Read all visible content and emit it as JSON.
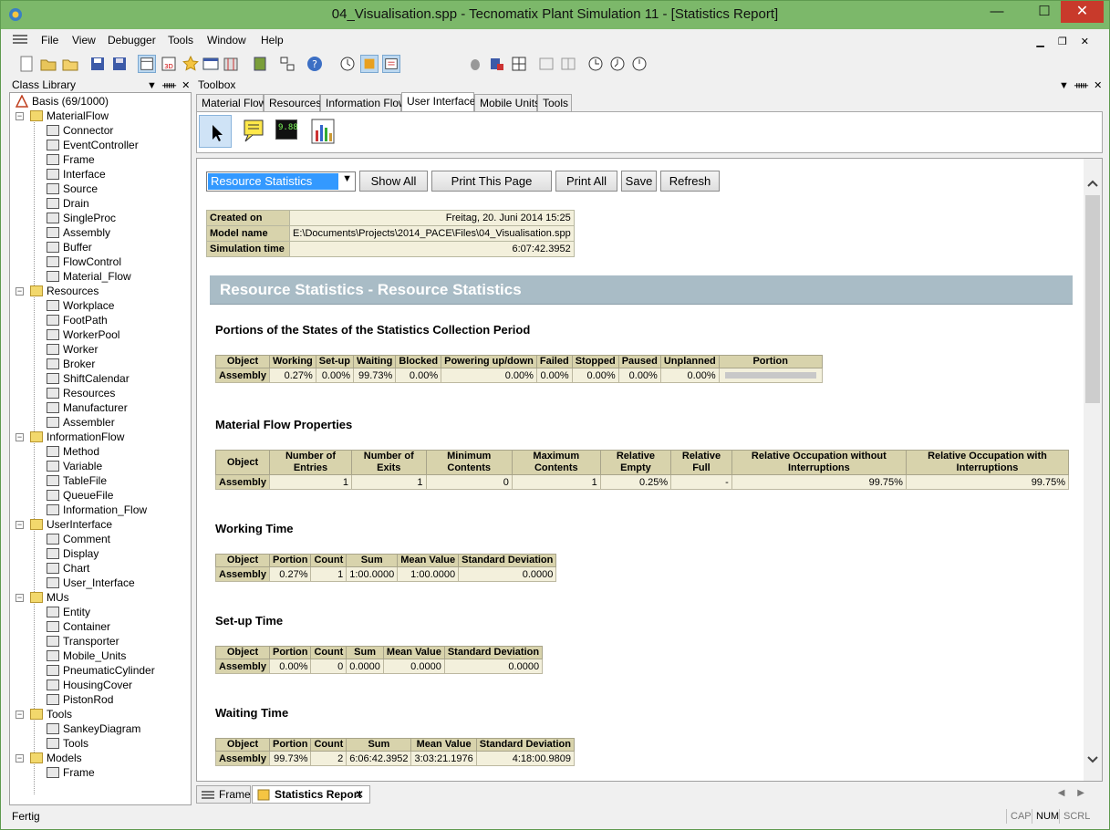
{
  "window": {
    "title": "04_Visualisation.spp - Tecnomatix Plant Simulation 11 - [Statistics Report]",
    "minimize": "—",
    "maximize": "☐",
    "close": "✕"
  },
  "menu": [
    "File",
    "View",
    "Debugger",
    "Tools",
    "Window",
    "Help"
  ],
  "class_library": {
    "title": "Class Library",
    "root": "Basis (69/1000)",
    "tree": [
      {
        "label": "MaterialFlow",
        "level": 1,
        "folder": true
      },
      {
        "label": "Connector",
        "level": 2
      },
      {
        "label": "EventController",
        "level": 2
      },
      {
        "label": "Frame",
        "level": 2
      },
      {
        "label": "Interface",
        "level": 2
      },
      {
        "label": "Source",
        "level": 2
      },
      {
        "label": "Drain",
        "level": 2
      },
      {
        "label": "SingleProc",
        "level": 2
      },
      {
        "label": "Assembly",
        "level": 2
      },
      {
        "label": "Buffer",
        "level": 2
      },
      {
        "label": "FlowControl",
        "level": 2
      },
      {
        "label": "Material_Flow",
        "level": 2
      },
      {
        "label": "Resources",
        "level": 1,
        "folder": true
      },
      {
        "label": "Workplace",
        "level": 2
      },
      {
        "label": "FootPath",
        "level": 2
      },
      {
        "label": "WorkerPool",
        "level": 2
      },
      {
        "label": "Worker",
        "level": 2
      },
      {
        "label": "Broker",
        "level": 2
      },
      {
        "label": "ShiftCalendar",
        "level": 2
      },
      {
        "label": "Resources",
        "level": 2
      },
      {
        "label": "Manufacturer",
        "level": 2
      },
      {
        "label": "Assembler",
        "level": 2
      },
      {
        "label": "InformationFlow",
        "level": 1,
        "folder": true
      },
      {
        "label": "Method",
        "level": 2
      },
      {
        "label": "Variable",
        "level": 2
      },
      {
        "label": "TableFile",
        "level": 2
      },
      {
        "label": "QueueFile",
        "level": 2
      },
      {
        "label": "Information_Flow",
        "level": 2
      },
      {
        "label": "UserInterface",
        "level": 1,
        "folder": true
      },
      {
        "label": "Comment",
        "level": 2
      },
      {
        "label": "Display",
        "level": 2
      },
      {
        "label": "Chart",
        "level": 2
      },
      {
        "label": "User_Interface",
        "level": 2
      },
      {
        "label": "MUs",
        "level": 1,
        "folder": true
      },
      {
        "label": "Entity",
        "level": 2
      },
      {
        "label": "Container",
        "level": 2
      },
      {
        "label": "Transporter",
        "level": 2
      },
      {
        "label": "Mobile_Units",
        "level": 2
      },
      {
        "label": "PneumaticCylinder",
        "level": 2
      },
      {
        "label": "HousingCover",
        "level": 2
      },
      {
        "label": "PistonRod",
        "level": 2
      },
      {
        "label": "Tools",
        "level": 1,
        "folder": true
      },
      {
        "label": "SankeyDiagram",
        "level": 2
      },
      {
        "label": "Tools",
        "level": 2
      },
      {
        "label": "Models",
        "level": 1,
        "folder": true
      },
      {
        "label": "Frame",
        "level": 2
      }
    ]
  },
  "toolbox": {
    "title": "Toolbox",
    "tabs": [
      "Material Flow",
      "Resources",
      "Information Flow",
      "User Interface",
      "Mobile Units",
      "Tools"
    ],
    "active_tab": "User Interface",
    "display_value": "9.88"
  },
  "report": {
    "select_value": "Resource Statistics",
    "buttons": [
      "Show All",
      "Print This Page",
      "Print All",
      "Save",
      "Refresh"
    ],
    "info": [
      {
        "label": "Created on",
        "value": "Freitag, 20. Juni 2014 15:25"
      },
      {
        "label": "Model name",
        "value": "E:\\Documents\\Projects\\2014_PACE\\Files\\04_Visualisation.spp"
      },
      {
        "label": "Simulation time",
        "value": "6:07:42.3952"
      }
    ],
    "banner": "Resource Statistics - Resource Statistics",
    "sections": {
      "portions": {
        "title": "Portions of the States of the Statistics Collection Period",
        "headers": [
          "Object",
          "Working",
          "Set-up",
          "Waiting",
          "Blocked",
          "Powering up/down",
          "Failed",
          "Stopped",
          "Paused",
          "Unplanned",
          "Portion"
        ],
        "row": [
          "Assembly",
          "0.27%",
          "0.00%",
          "99.73%",
          "0.00%",
          "0.00%",
          "0.00%",
          "0.00%",
          "0.00%",
          "0.00%"
        ]
      },
      "material": {
        "title": "Material Flow Properties",
        "headers": [
          "Object",
          "Number of Entries",
          "Number of Exits",
          "Minimum Contents",
          "Maximum Contents",
          "Relative Empty",
          "Relative Full",
          "Relative Occupation without Interruptions",
          "Relative Occupation with Interruptions"
        ],
        "row": [
          "Assembly",
          "1",
          "1",
          "0",
          "1",
          "0.25%",
          "-",
          "99.75%",
          "99.75%"
        ]
      },
      "working": {
        "title": "Working Time",
        "headers": [
          "Object",
          "Portion",
          "Count",
          "Sum",
          "Mean Value",
          "Standard Deviation"
        ],
        "row": [
          "Assembly",
          "0.27%",
          "1",
          "1:00.0000",
          "1:00.0000",
          "0.0000"
        ]
      },
      "setup": {
        "title": "Set-up Time",
        "headers": [
          "Object",
          "Portion",
          "Count",
          "Sum",
          "Mean Value",
          "Standard Deviation"
        ],
        "row": [
          "Assembly",
          "0.00%",
          "0",
          "0.0000",
          "0.0000",
          "0.0000"
        ]
      },
      "waiting": {
        "title": "Waiting Time",
        "headers": [
          "Object",
          "Portion",
          "Count",
          "Sum",
          "Mean Value",
          "Standard Deviation"
        ],
        "row": [
          "Assembly",
          "99.73%",
          "2",
          "6:06:42.3952",
          "3:03:21.1976",
          "4:18:00.9809"
        ]
      }
    }
  },
  "bottom_tabs": [
    "Frame",
    "Statistics Report"
  ],
  "status": {
    "text": "Fertig",
    "indicators": [
      "CAP",
      "NUM",
      "SCRL"
    ]
  }
}
